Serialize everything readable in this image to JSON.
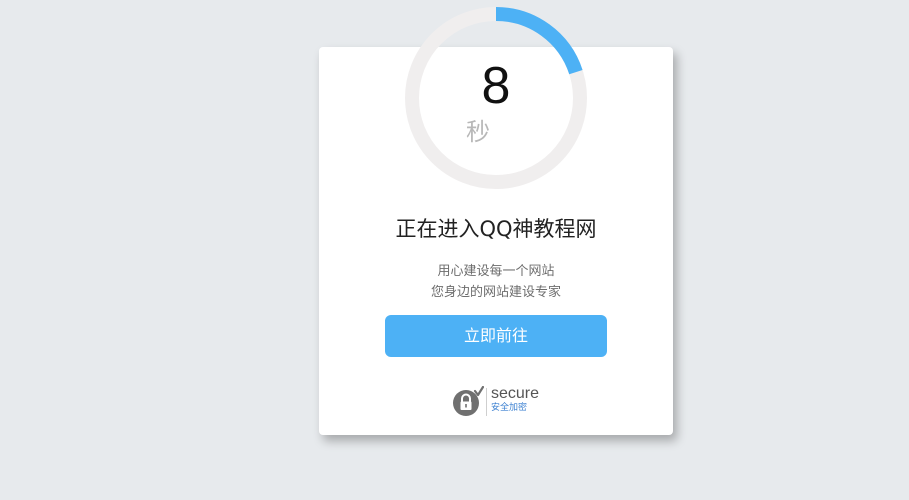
{
  "countdown": {
    "number": "8",
    "unit": "秒",
    "progress_fraction": 0.2,
    "track_color": "#f0eeee",
    "progress_color": "#4db1f5"
  },
  "card": {
    "title": "正在进入QQ神教程网",
    "subtitle_line1": "用心建设每一个网站",
    "subtitle_line2": "您身边的网站建设专家"
  },
  "button": {
    "label": "立即前往",
    "color": "#4db1f5"
  },
  "secure_badge": {
    "word": "secure",
    "chinese": "安全加密",
    "icon": "lock-check-icon"
  }
}
